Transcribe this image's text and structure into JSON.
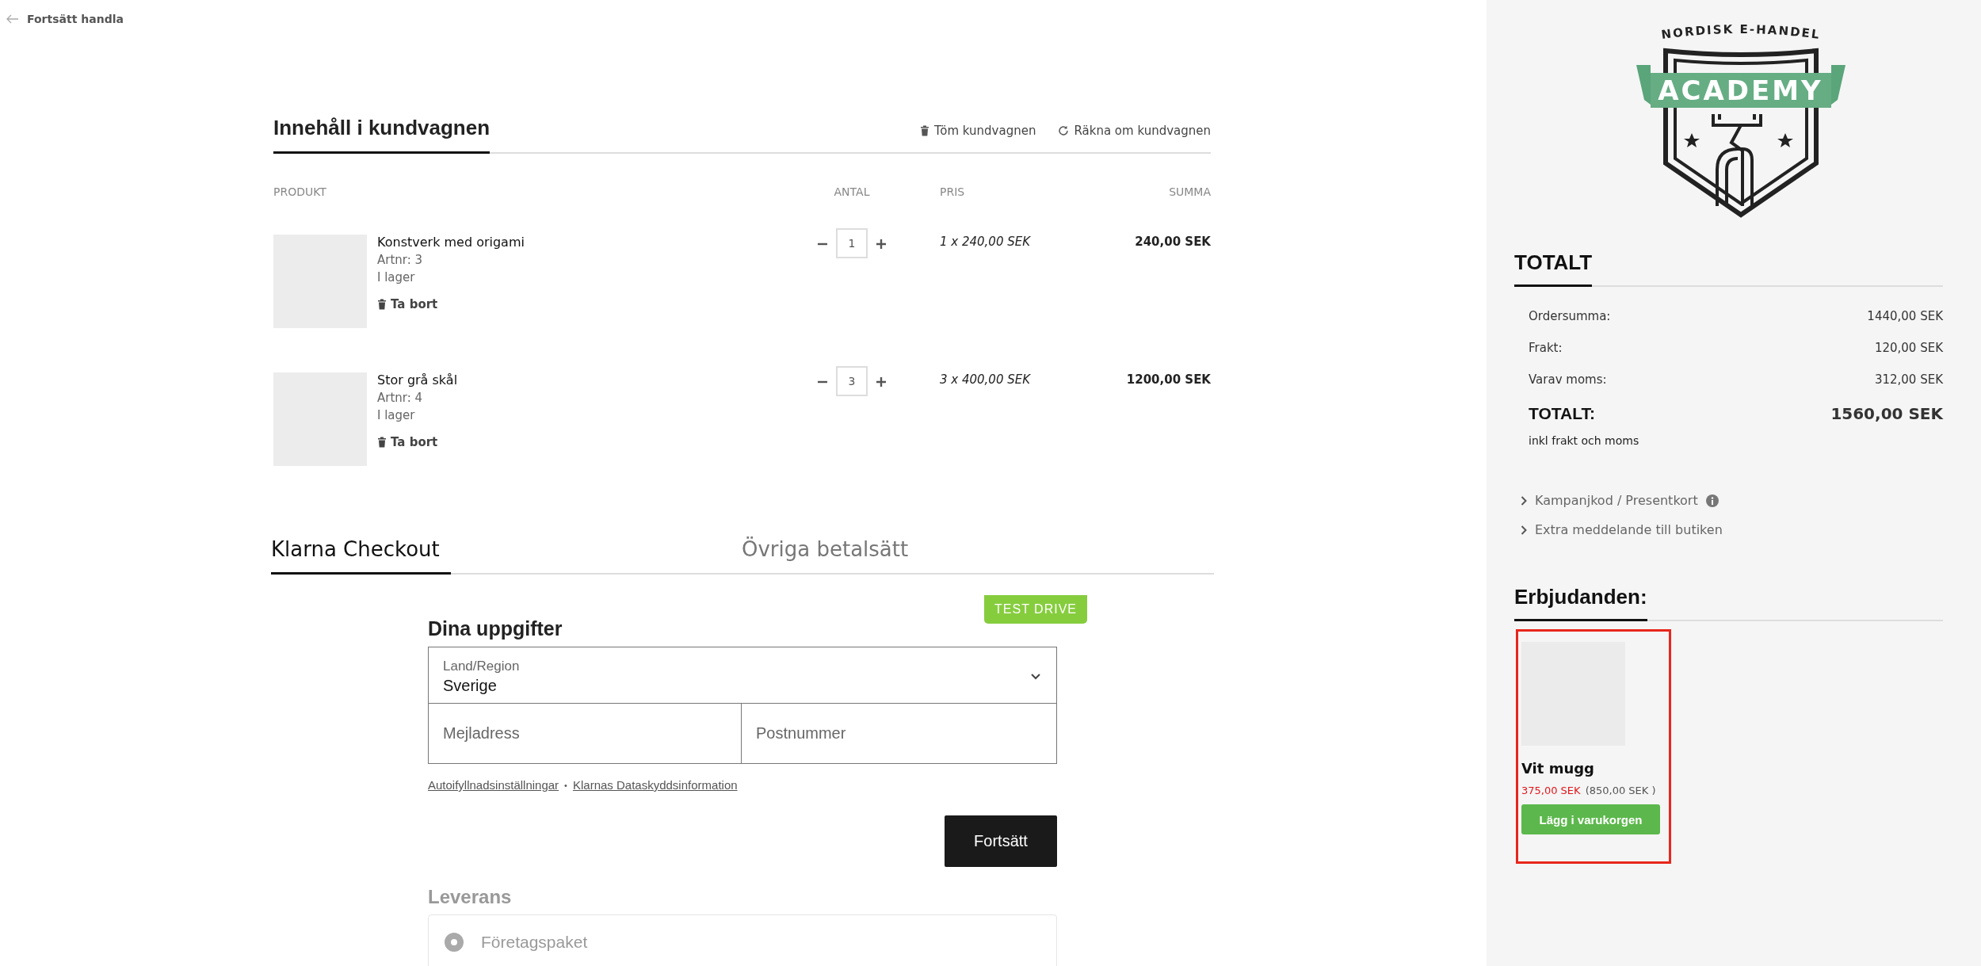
{
  "back_link": {
    "label": "Fortsätt handla"
  },
  "cart": {
    "title": "Innehåll i kundvagnen",
    "actions": [
      {
        "kind": "empty",
        "label": "Töm kundvagnen"
      },
      {
        "kind": "recalc",
        "label": "Räkna om kundvagnen"
      }
    ],
    "columns": [
      "PRODUKT",
      "ANTAL",
      "PRIS",
      "SUMMA"
    ],
    "items": [
      {
        "name": "Konstverk med origami",
        "sku": "Artnr: 3",
        "stock": "I lager",
        "remove": "Ta bort",
        "quantity": "1",
        "price": "1 x 240,00 SEK",
        "total": "240,00 SEK"
      },
      {
        "name": "Stor grå skål",
        "sku": "Artnr: 4",
        "stock": "I lager",
        "remove": "Ta bort",
        "quantity": "3",
        "price": "3 x 400,00 SEK",
        "total": "1200,00 SEK"
      }
    ]
  },
  "payment_tabs": [
    {
      "label": "Klarna Checkout",
      "selected": true
    },
    {
      "label": "Övriga betalsätt",
      "selected": false
    }
  ],
  "checkout": {
    "badge": "TEST DRIVE",
    "title": "Dina uppgifter",
    "country": {
      "label": "Land/Region",
      "value": "Sverige"
    },
    "email": {
      "placeholder": "Mejladress"
    },
    "postcode": {
      "placeholder": "Postnummer"
    },
    "links": [
      "Autoifyllnadsinställningar",
      "Klarnas Dataskyddsinformation"
    ],
    "link_separator": "•",
    "continue": "Fortsätt",
    "delivery": {
      "title": "Leverans",
      "options": [
        {
          "label": "Företagspaket",
          "selected": true
        }
      ]
    }
  },
  "logo": {
    "top": "NORDISK E-HANDEL",
    "banner": "ACADEMY"
  },
  "totals": {
    "title": "TOTALT",
    "rows": [
      {
        "label": "Ordersumma:",
        "value": "1440,00 SEK"
      },
      {
        "label": "Frakt:",
        "value": "120,00 SEK"
      },
      {
        "label": "Varav moms:",
        "value": "312,00 SEK"
      }
    ],
    "grand": {
      "label": "TOTALT:",
      "value": "1560,00 SEK"
    },
    "note": "inkl frakt och moms"
  },
  "expanders": [
    {
      "label": "Kampanjkod / Presentkort",
      "info": true
    },
    {
      "label": "Extra meddelande till butiken",
      "info": false
    }
  ],
  "offers": {
    "title": "Erbjudanden:",
    "items": [
      {
        "name": "Vit mugg",
        "price": "375,00 SEK",
        "old_price": "(850,00 SEK )",
        "button": "Lägg i varukorgen",
        "highlighted": true
      }
    ]
  }
}
